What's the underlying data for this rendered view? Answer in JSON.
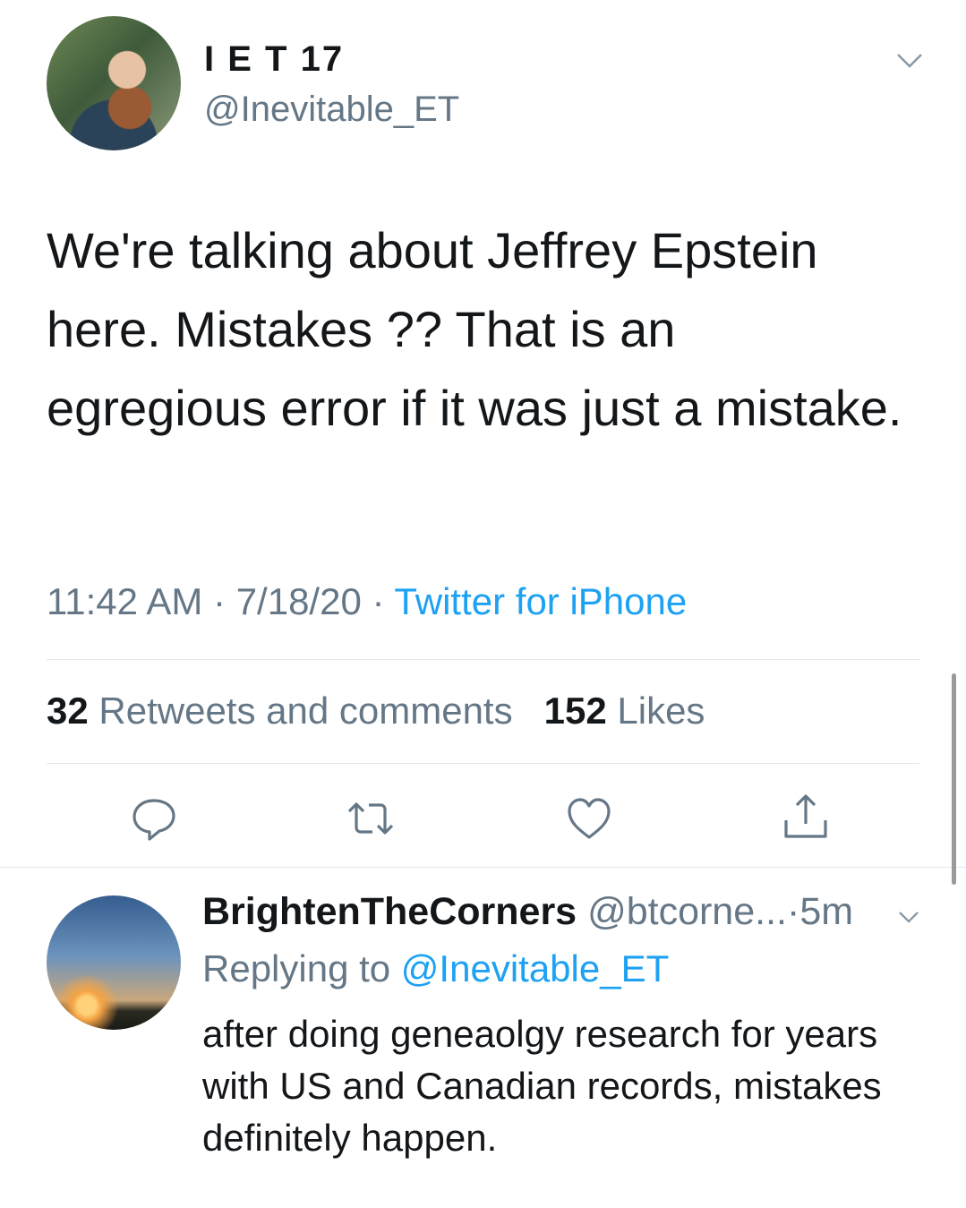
{
  "tweet": {
    "display_name": "I E T 17",
    "handle": "@Inevitable_ET",
    "text": "We're talking about Jeffrey Epstein here. Mistakes ?? That is an egregious error if it was just a mistake.",
    "time": "11:42 AM",
    "date": "7/18/20",
    "separator": "·",
    "source": "Twitter for iPhone",
    "retweets_count": "32",
    "retweets_label": "Retweets and comments",
    "likes_count": "152",
    "likes_label": "Likes"
  },
  "actions": {
    "reply_icon": "comment-bubble-icon",
    "retweet_icon": "retweet-icon",
    "like_icon": "heart-icon",
    "share_icon": "share-icon"
  },
  "reply": {
    "display_name": "BrightenTheCorners",
    "handle": "@btcorne...",
    "age": "5m",
    "separator": "·",
    "replying_prefix": "Replying to",
    "replying_to": "@Inevitable_ET",
    "text": "after doing geneaolgy research for years with US and Canadian records, mistakes definitely happen."
  },
  "colors": {
    "accent": "#1da1f2",
    "muted": "#657786",
    "text": "#14171a",
    "divider": "#e1e8ed"
  }
}
